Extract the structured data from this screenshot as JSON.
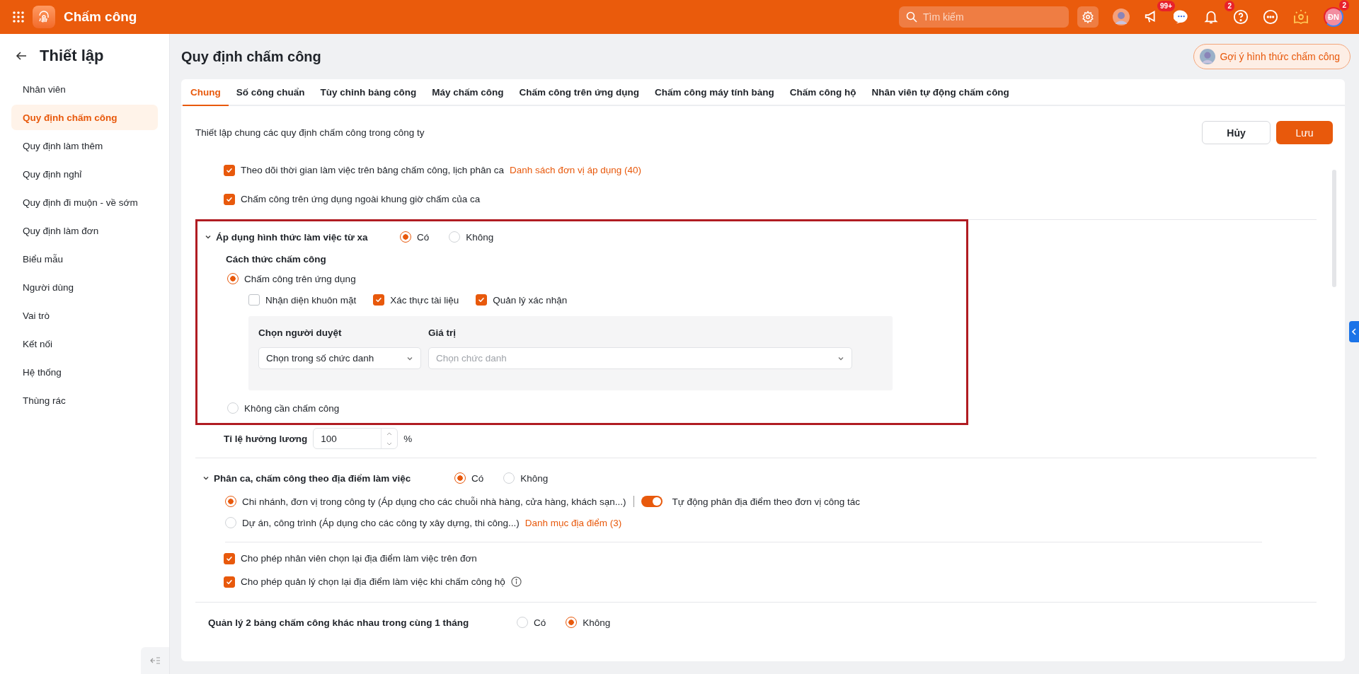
{
  "topbar": {
    "app_title": "Chấm công",
    "search_placeholder": "Tìm kiếm",
    "announcement_badge": "99+",
    "notification_badge": "2",
    "user_initials": "ĐN",
    "user_badge": "2"
  },
  "sidebar": {
    "title": "Thiết lập",
    "items": [
      {
        "label": "Nhân viên",
        "selected": false
      },
      {
        "label": "Quy định chấm công",
        "selected": true
      },
      {
        "label": "Quy định làm thêm",
        "selected": false
      },
      {
        "label": "Quy định nghỉ",
        "selected": false
      },
      {
        "label": "Quy định đi muộn - về sớm",
        "selected": false
      },
      {
        "label": "Quy định làm đơn",
        "selected": false
      },
      {
        "label": "Biểu mẫu",
        "selected": false
      },
      {
        "label": "Người dùng",
        "selected": false
      },
      {
        "label": "Vai trò",
        "selected": false
      },
      {
        "label": "Kết nối",
        "selected": false
      },
      {
        "label": "Hệ thống",
        "selected": false
      },
      {
        "label": "Thùng rác",
        "selected": false
      }
    ]
  },
  "page": {
    "title": "Quy định chấm công",
    "suggest_button": "Gợi ý hình thức chấm công"
  },
  "tabs": [
    {
      "label": "Chung",
      "selected": true
    },
    {
      "label": "Số công chuẩn",
      "selected": false
    },
    {
      "label": "Tùy chỉnh bảng công",
      "selected": false
    },
    {
      "label": "Máy chấm công",
      "selected": false
    },
    {
      "label": "Chấm công trên ứng dụng",
      "selected": false
    },
    {
      "label": "Chấm công máy tính bảng",
      "selected": false
    },
    {
      "label": "Chấm công hộ",
      "selected": false
    },
    {
      "label": "Nhân viên tự động chấm công",
      "selected": false
    }
  ],
  "description": "Thiết lập chung các quy định chấm công trong công ty",
  "buttons": {
    "cancel": "Hủy",
    "save": "Lưu"
  },
  "general_options": [
    {
      "label": "Theo dõi thời gian làm việc trên bảng chấm công, lịch phân ca",
      "checked": true,
      "link": "Danh sách đơn vị áp dụng (40)"
    },
    {
      "label": "Chấm công trên ứng dụng ngoài khung giờ chấm của ca",
      "checked": true
    }
  ],
  "remote_work": {
    "title": "Áp dụng hình thức làm việc từ xa",
    "expanded": true,
    "highlighted": true,
    "choices": [
      {
        "label": "Có",
        "selected": true
      },
      {
        "label": "Không",
        "selected": false
      }
    ],
    "method_title": "Cách thức chấm công",
    "methods": [
      {
        "label": "Chấm công trên ứng dụng",
        "selected": true,
        "checks": [
          {
            "label": "Nhận diện khuôn mặt",
            "checked": false
          },
          {
            "label": "Xác thực tài liệu",
            "checked": true
          },
          {
            "label": "Quản lý xác nhận",
            "checked": true
          }
        ],
        "approver": {
          "approver_label": "Chọn người duyệt",
          "value_label": "Giá trị",
          "approver_value": "Chọn trong số chức danh",
          "value_placeholder": "Chọn chức danh"
        }
      },
      {
        "label": "Không cần chấm công",
        "selected": false
      }
    ]
  },
  "salary_rate": {
    "label": "Tỉ lệ hưởng lương",
    "value": "100",
    "unit": "%"
  },
  "location": {
    "title": "Phân ca, chấm công theo địa điểm làm việc",
    "expanded": true,
    "choices": [
      {
        "label": "Có",
        "selected": true
      },
      {
        "label": "Không",
        "selected": false
      }
    ],
    "methods": [
      {
        "label": "Chi nhánh, đơn vị trong công ty (Áp dụng cho các chuỗi nhà hàng, cửa hàng, khách sạn...)",
        "selected": true,
        "toggle": {
          "label": "Tự động phân địa điểm theo đơn vị công tác",
          "on": true
        }
      },
      {
        "label": "Dự án, công trình (Áp dụng cho các công ty xây dựng, thi công...)",
        "selected": false,
        "link": "Danh mục địa điểm (3)"
      }
    ],
    "checks": [
      {
        "label": "Cho phép nhân viên chọn lại địa điểm làm việc trên đơn",
        "checked": true,
        "info": false
      },
      {
        "label": "Cho phép quản lý chọn lại địa điểm làm việc khi chấm công hộ",
        "checked": true,
        "info": true
      }
    ]
  },
  "two_sheets": {
    "label": "Quản lý 2 bảng chấm công khác nhau trong cùng 1 tháng",
    "choices": [
      {
        "label": "Có",
        "selected": false
      },
      {
        "label": "Không",
        "selected": true
      }
    ]
  }
}
